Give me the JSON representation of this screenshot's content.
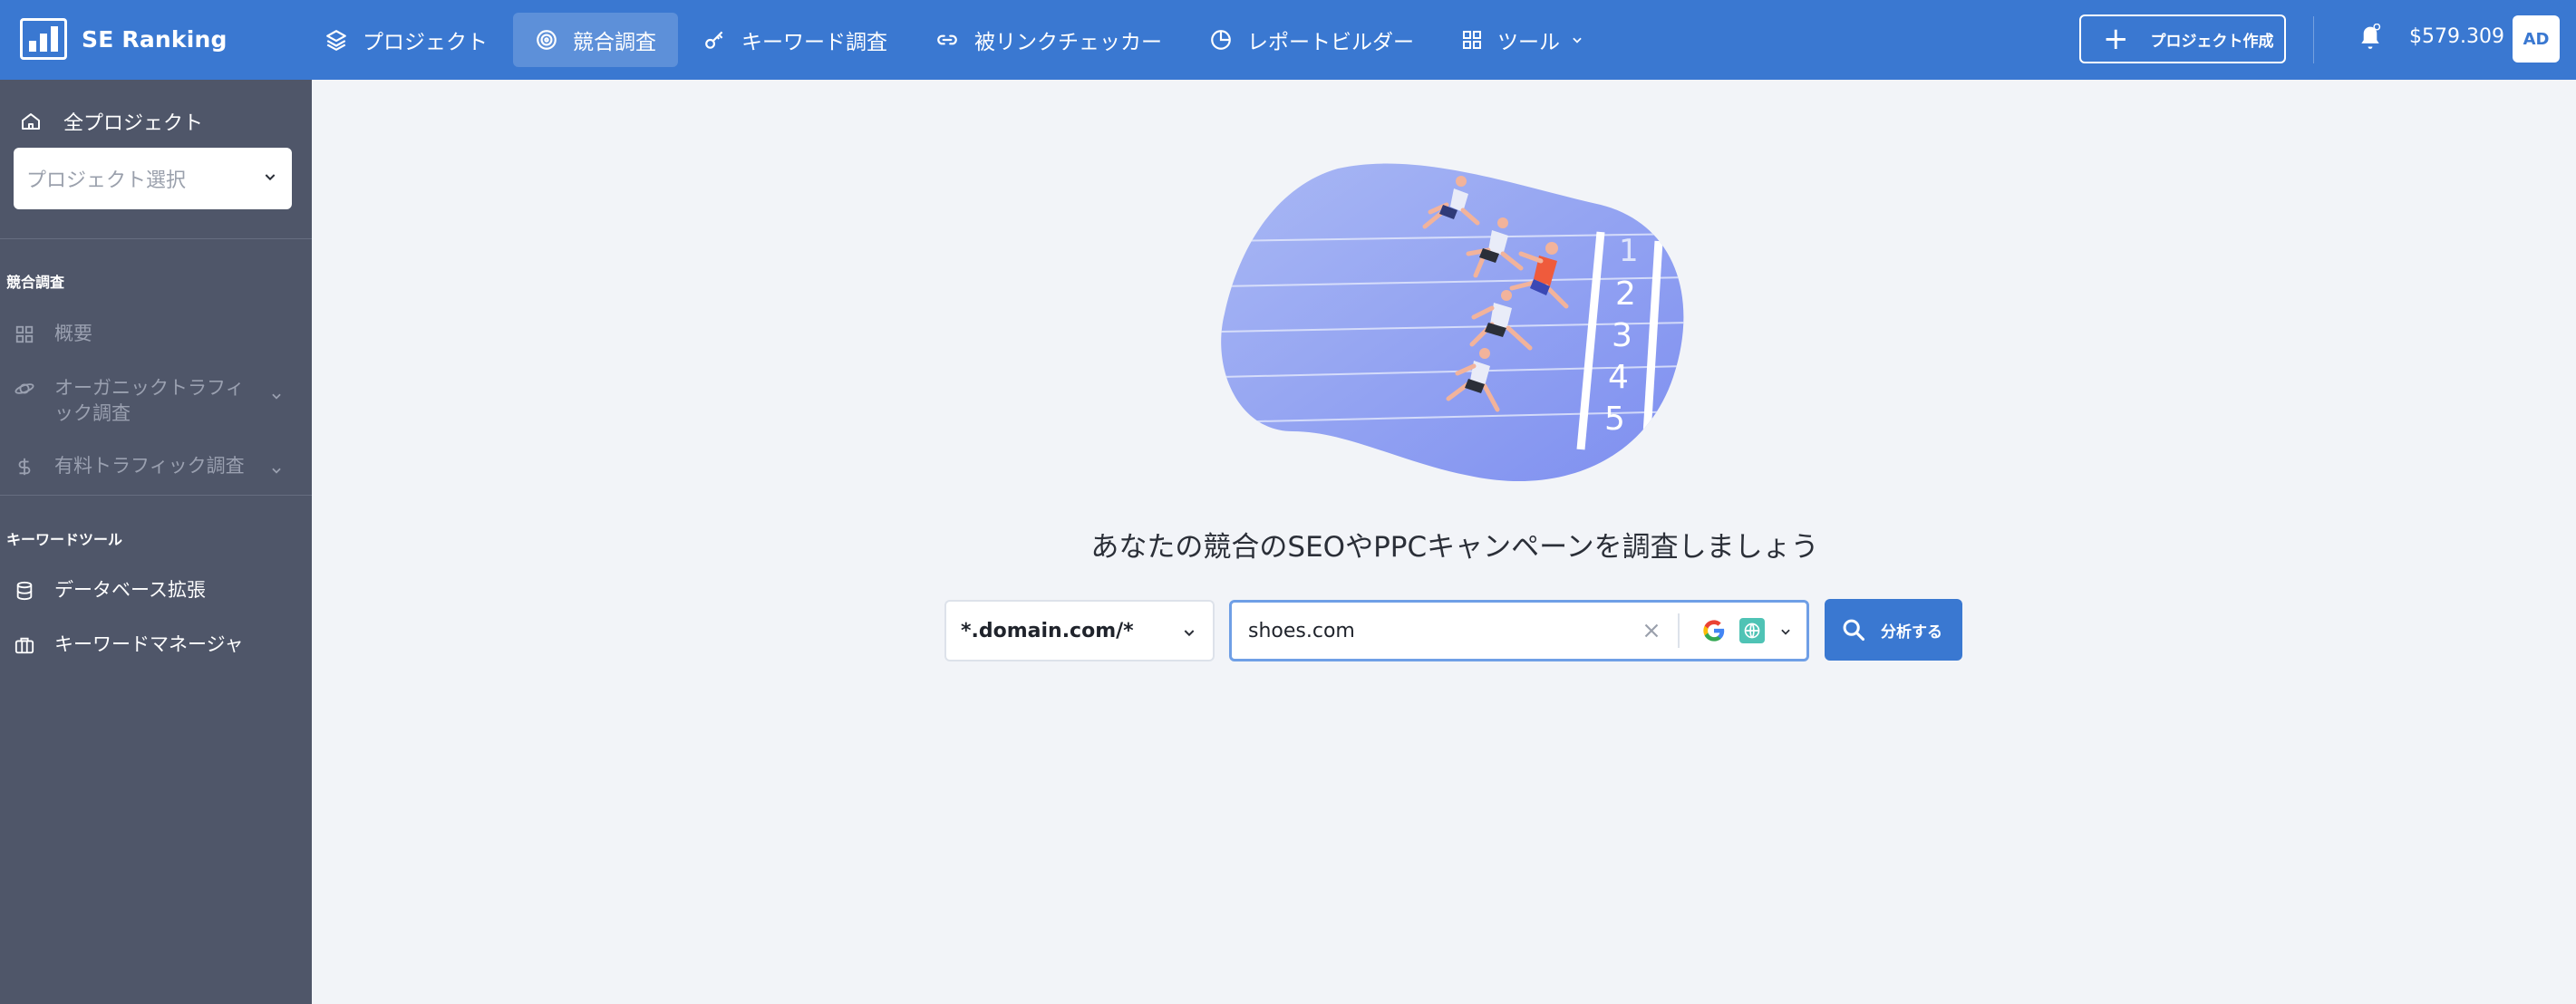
{
  "brand": {
    "name": "SE Ranking"
  },
  "nav": {
    "items": [
      {
        "label": "プロジェクト",
        "icon": "layers-icon"
      },
      {
        "label": "競合調査",
        "icon": "target-icon",
        "active": true
      },
      {
        "label": "キーワード調査",
        "icon": "key-icon"
      },
      {
        "label": "被リンクチェッカー",
        "icon": "link-icon"
      },
      {
        "label": "レポートビルダー",
        "icon": "pie-chart-icon"
      },
      {
        "label": "ツール",
        "icon": "grid-icon"
      }
    ]
  },
  "header": {
    "create_project_label": "プロジェクト作成",
    "balance": "$579.309",
    "avatar_initials": "AD"
  },
  "sidebar": {
    "all_projects_label": "全プロジェクト",
    "project_select_placeholder": "プロジェクト選択",
    "competitor_section": "競合調査",
    "competitor_items": [
      {
        "label": "概要",
        "icon": "grid-icon"
      },
      {
        "label": "オーガニックトラフィック調査",
        "line1": "オーガニックトラフィ",
        "line2": "ック調査",
        "icon": "planet-icon"
      },
      {
        "label": "有料トラフィック調査",
        "icon": "dollar-icon"
      }
    ],
    "keyword_section": "キーワードツール",
    "keyword_items": [
      {
        "label": "データベース拡張",
        "icon": "database-icon"
      },
      {
        "label": "キーワードマネージャ",
        "icon": "briefcase-icon"
      }
    ]
  },
  "main": {
    "headline": "あなたの競合のSEOやPPCキャンペーンを調査しましょう",
    "domain_mode": "*.domain.com/*",
    "search_value": "shoes.com",
    "search_engine_icon": "google-icon",
    "region_icon": "globe-icon",
    "analyze_label": "分析する"
  },
  "colors": {
    "brand_blue": "#3a78d1",
    "sidebar_bg": "#4f5669",
    "page_bg": "#f2f4f8"
  }
}
